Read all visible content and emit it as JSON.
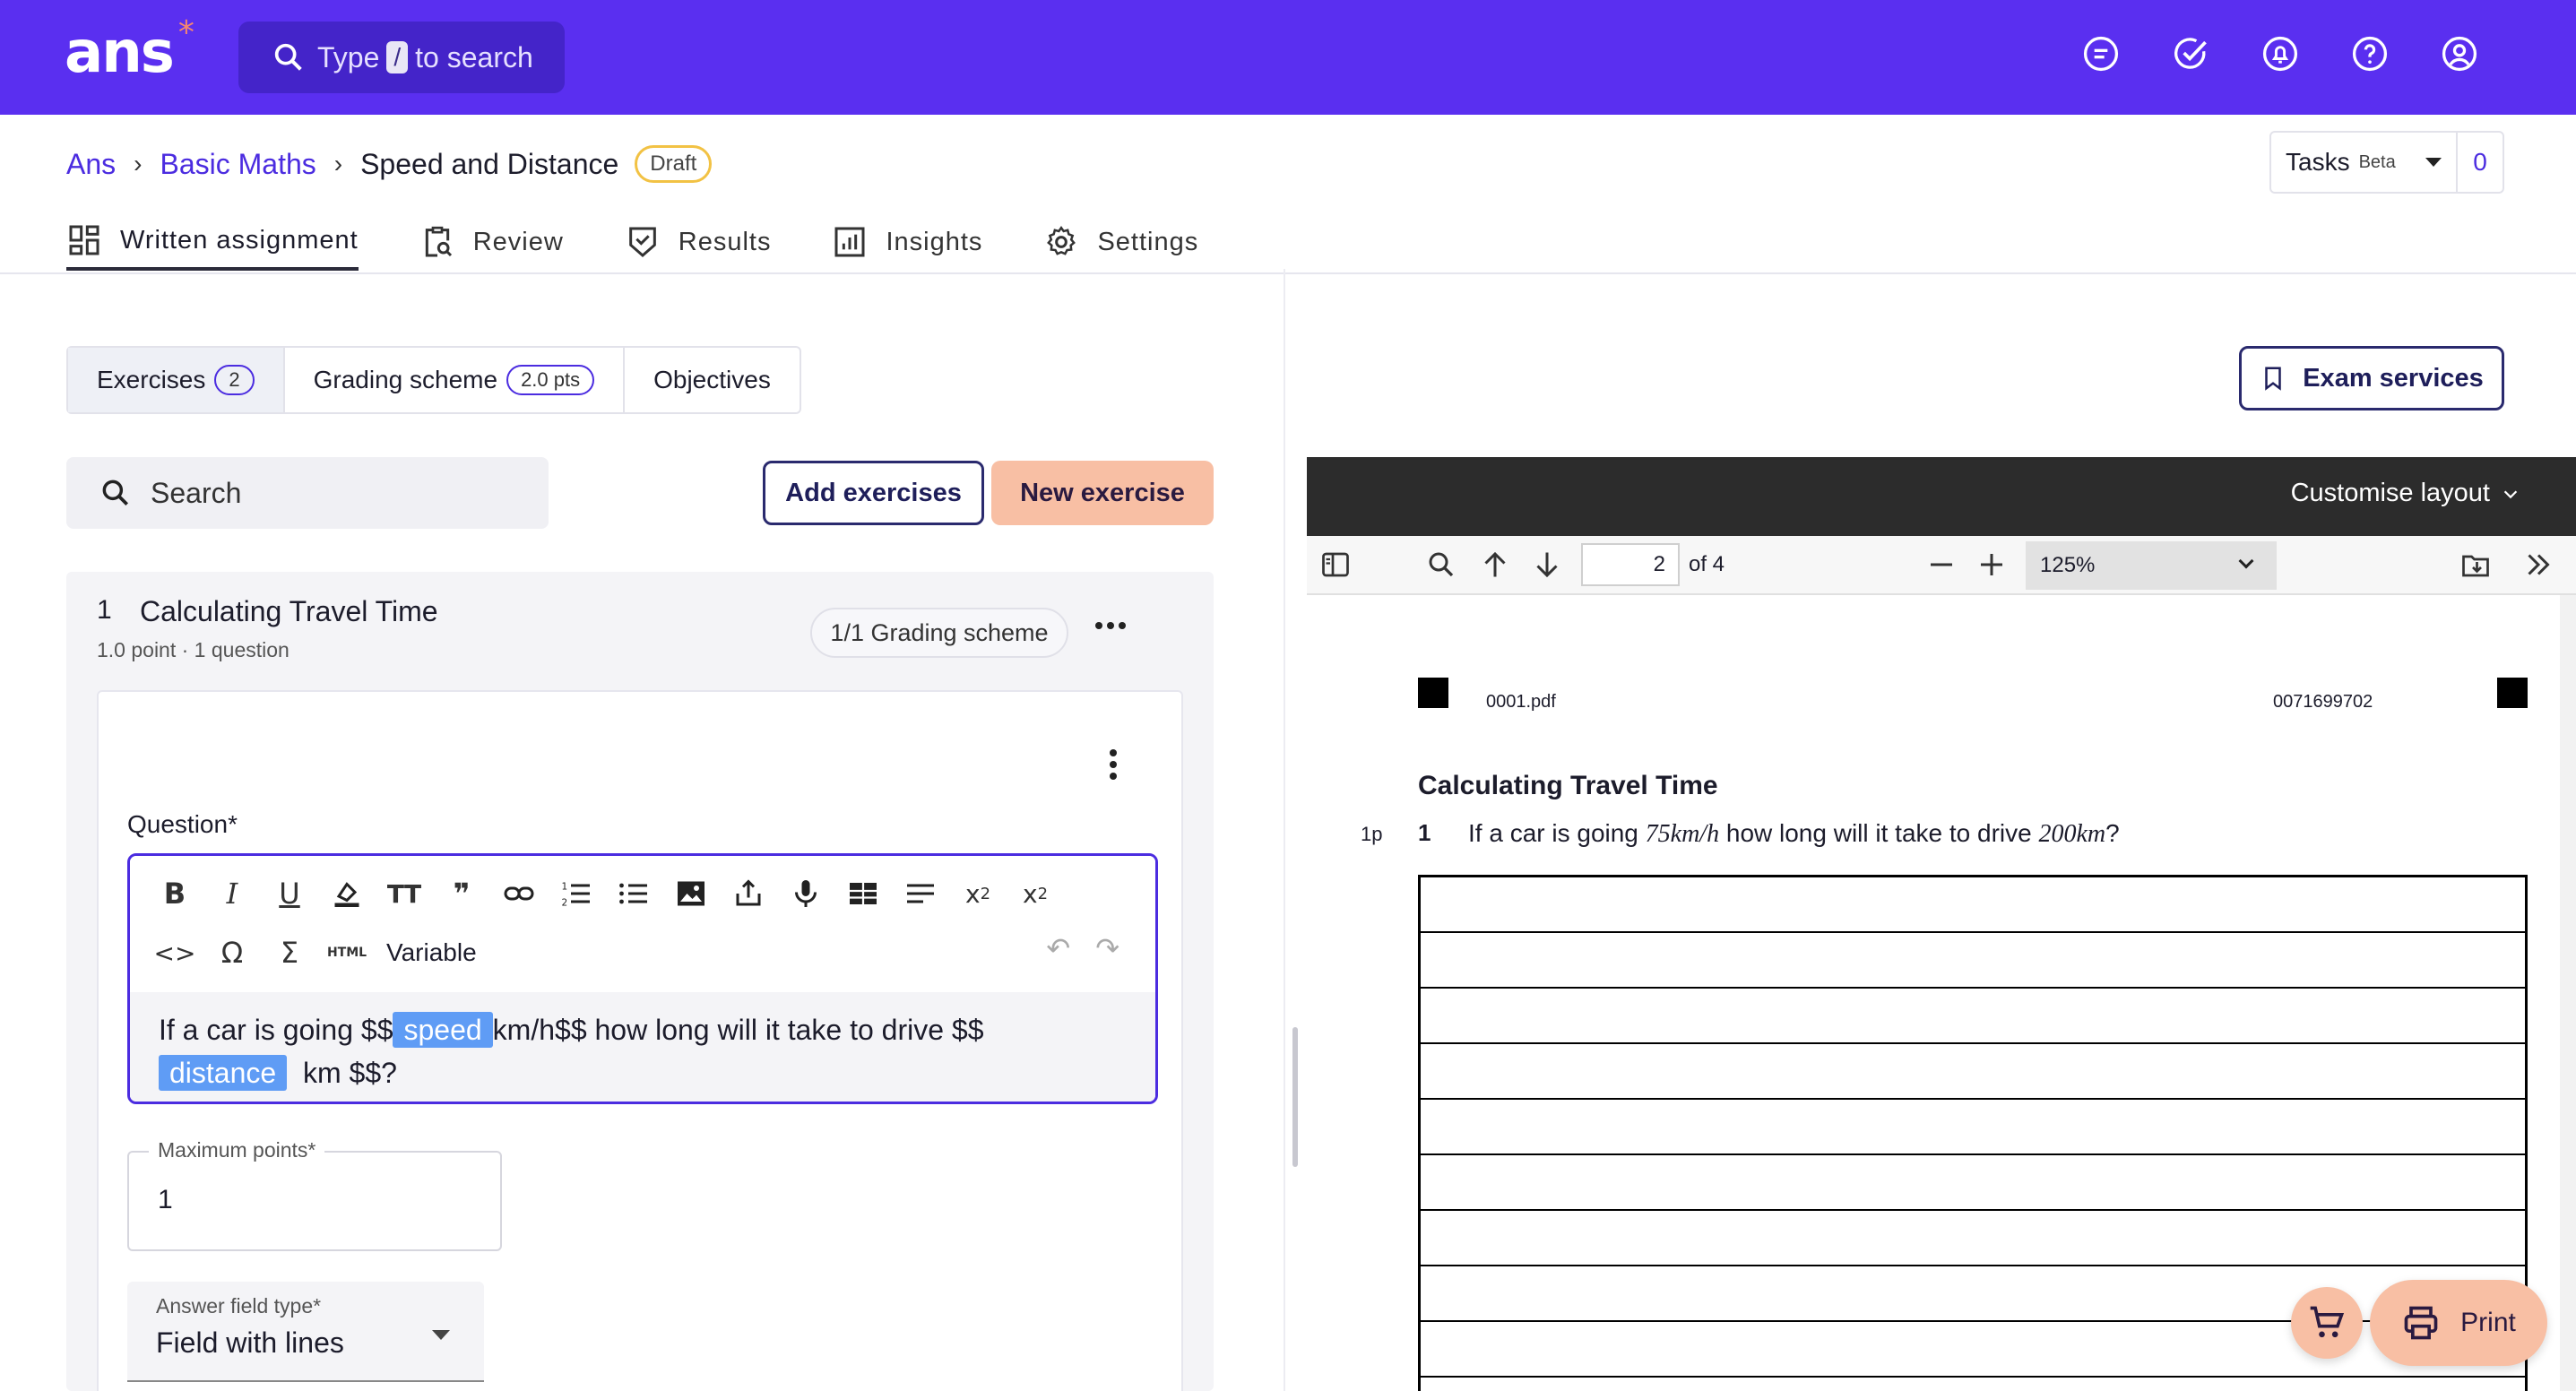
{
  "app": {
    "logo": "ans",
    "logo_mark": "*"
  },
  "search": {
    "prefix": "Type",
    "key": "/",
    "suffix": "to search"
  },
  "top_icons": [
    "chat-icon",
    "check-circle-icon",
    "notification-icon",
    "help-icon",
    "account-icon"
  ],
  "breadcrumb": {
    "root": "Ans",
    "course": "Basic Maths",
    "current": "Speed and Distance",
    "status": "Draft"
  },
  "tasks": {
    "label": "Tasks",
    "badge": "Beta",
    "count": "0"
  },
  "nav_tabs": [
    {
      "label": "Written assignment",
      "icon": "layout-icon",
      "active": true
    },
    {
      "label": "Review",
      "icon": "review-icon"
    },
    {
      "label": "Results",
      "icon": "results-icon"
    },
    {
      "label": "Insights",
      "icon": "insights-icon"
    },
    {
      "label": "Settings",
      "icon": "gear-icon"
    }
  ],
  "sub_tabs": {
    "exercises": {
      "label": "Exercises",
      "count": "2"
    },
    "grading": {
      "label": "Grading scheme",
      "count": "2.0 pts"
    },
    "objectives": {
      "label": "Objectives"
    }
  },
  "exam_services": "Exam services",
  "exercise_search": {
    "placeholder": "Search"
  },
  "actions": {
    "add": "Add exercises",
    "new": "New exercise"
  },
  "exercise": {
    "number": "1",
    "title": "Calculating Travel Time",
    "meta": "1.0 point · 1 question",
    "grading": "1/1 Grading scheme",
    "question_label": "Question*",
    "toolbar_variable": "Variable",
    "text": {
      "p1": "If a car is going $$",
      "var1": "speed",
      "p2": "km/h$$ how long will it take to drive $$",
      "var2": "distance",
      "p3": "km $$?"
    },
    "max_points": {
      "label": "Maximum points*",
      "value": "1"
    },
    "answer_type": {
      "label": "Answer field type*",
      "value": "Field with lines"
    }
  },
  "pdf": {
    "customise": "Customise layout",
    "page": "2",
    "page_of": "of 4",
    "zoom": "125%",
    "filename": "0001.pdf",
    "doc_id": "0071699702",
    "title": "Calculating Travel Time",
    "points": "1p",
    "q_number": "1",
    "q_text": {
      "p1": "If a car is going ",
      "v1": "75km/h",
      "p2": " how long will it take to drive ",
      "v2": "200km",
      "p3": "?"
    }
  },
  "print": "Print"
}
